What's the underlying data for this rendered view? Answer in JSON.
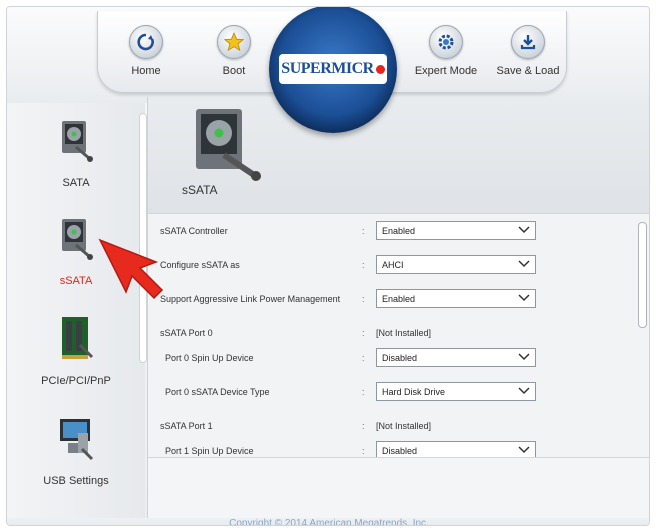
{
  "toolbar": {
    "tabs": [
      {
        "label": "Home",
        "icon": "power-icon"
      },
      {
        "label": "Boot",
        "icon": "star-icon"
      },
      {
        "label": "Expert Mode",
        "icon": "gear-icon"
      },
      {
        "label": "Save & Load",
        "icon": "download-icon"
      }
    ]
  },
  "logo": {
    "text": "SUPERMICR"
  },
  "sidebar": {
    "items": [
      {
        "label": "SATA",
        "icon": "hard-drive-tools-icon"
      },
      {
        "label": "sSATA",
        "icon": "hard-drive-tools-icon",
        "active": true
      },
      {
        "label": "PCIe/PCI/PnP",
        "icon": "pci-card-icon"
      },
      {
        "label": "USB Settings",
        "icon": "usb-computer-icon"
      }
    ]
  },
  "main": {
    "title": "sSATA",
    "rows": [
      {
        "label": "sSATA Controller",
        "value": "Enabled",
        "type": "dropdown"
      },
      {
        "label": "Configure sSATA as",
        "value": "AHCI",
        "type": "dropdown"
      },
      {
        "label": "Support Aggressive Link Power Management",
        "value": "Enabled",
        "type": "dropdown"
      },
      {
        "label": "sSATA Port 0",
        "value": "[Not Installed]",
        "type": "text"
      },
      {
        "label": "Port 0 Spin Up Device",
        "value": "Disabled",
        "type": "dropdown"
      },
      {
        "label": "Port 0 sSATA Device Type",
        "value": "Hard Disk Drive",
        "type": "dropdown"
      },
      {
        "label": "sSATA Port 1",
        "value": "[Not Installed]",
        "type": "text"
      },
      {
        "label": "Port 1 Spin Up Device",
        "value": "Disabled",
        "type": "dropdown"
      }
    ],
    "colon": ":"
  },
  "footer": {
    "copyright": "Copyright © 2014 American Megatrends, Inc."
  },
  "colors": {
    "accent_red": "#e0251b",
    "brand_blue": "#1d4e9a",
    "copyright_blue": "#8da4c4"
  }
}
